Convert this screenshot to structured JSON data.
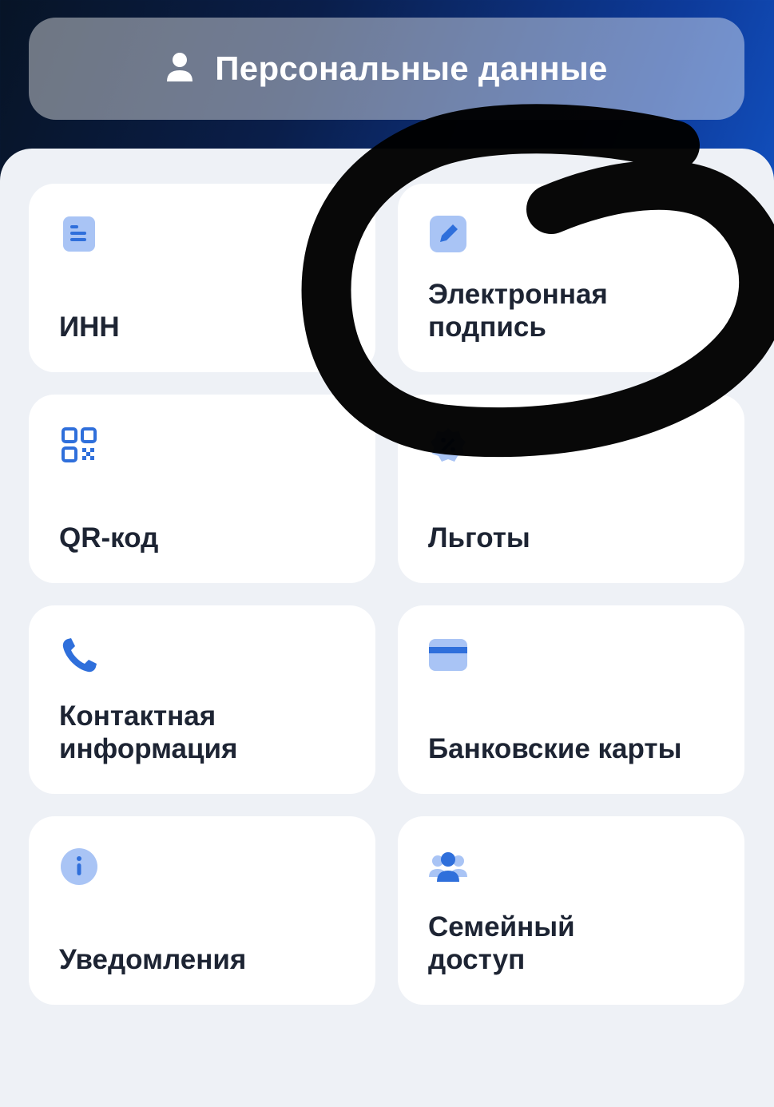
{
  "header": {
    "title": "Персональные данные",
    "icon": "person-icon"
  },
  "tiles": [
    {
      "label": "ИНН",
      "icon": "document-icon"
    },
    {
      "label": "Электронная\nподпись",
      "icon": "pencil-icon"
    },
    {
      "label": "QR-код",
      "icon": "qr-code-icon"
    },
    {
      "label": "Льготы",
      "icon": "discount-badge-icon"
    },
    {
      "label": "Контактная\nинформация",
      "icon": "phone-icon"
    },
    {
      "label": "Банковские карты",
      "icon": "bank-card-icon"
    },
    {
      "label": "Уведомления",
      "icon": "info-icon"
    },
    {
      "label": "Семейный\nдоступ",
      "icon": "family-icon"
    }
  ],
  "colors": {
    "accent": "#2f6fdb",
    "icon_bg": "#a9c4f5",
    "tile_bg": "#ffffff",
    "panel_bg": "#eef1f6",
    "text": "#1d2433"
  }
}
